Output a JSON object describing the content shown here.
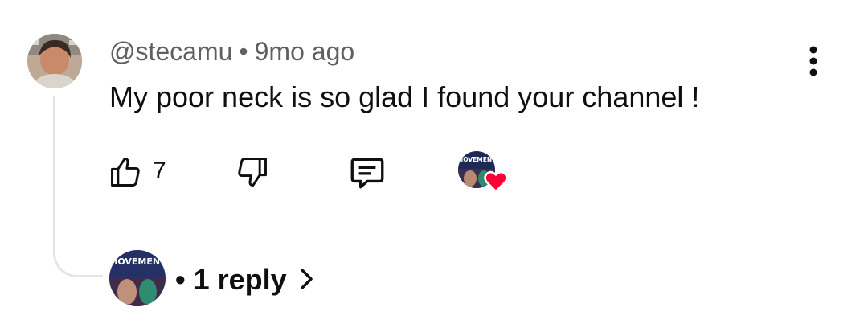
{
  "comment": {
    "author": "@stecamu",
    "separator": "•",
    "time": "9mo ago",
    "text": "My poor neck is so glad I found your channel !"
  },
  "actions": {
    "like_count": "7",
    "icons": [
      "thumb-up-icon",
      "thumb-down-icon",
      "reply-icon",
      "heart-icon"
    ]
  },
  "creator_avatar_text": "MOVEMENT",
  "replies": {
    "separator": "•",
    "label": "1 reply"
  },
  "colors": {
    "meta": "#606060",
    "text": "#0f0f0f",
    "heart": "#ff0033",
    "thread_line": "#e5e5e5"
  }
}
